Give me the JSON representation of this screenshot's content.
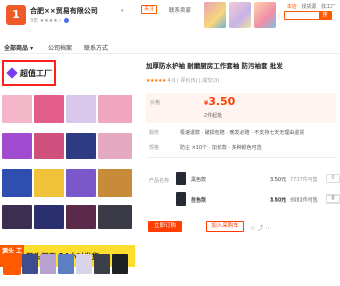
{
  "header": {
    "logo_char": "1",
    "shop_name": "合肥××贸易有限公司",
    "shop_meta_text": "3年 ★★★★☆",
    "chevron": "▾",
    "follow_label": "关注",
    "contact_label": "联系卖家",
    "links": {
      "first": "本店",
      "second": "找货源",
      "third": "找工厂"
    },
    "search_button": "搜"
  },
  "nav": {
    "items": [
      "全部商品 ▾",
      "公司档案",
      "联系方式"
    ]
  },
  "gallery": {
    "badge_label": "超值工厂",
    "banner_side": "源头 工厂",
    "banner_text": "源头厂家 24小时发货"
  },
  "product": {
    "title": "加厚防水护袖 耐磨厨房工作套袖 防污袖套 批发",
    "rating_stars": "★★★★★",
    "rating_text": "4.0 | 评价(5) | 成交(3)",
    "price_label": "价格",
    "price_currency": "¥",
    "price_value": "3.50",
    "moq": "2件起批",
    "service_label": "服务",
    "service_text": "极速退款 · 破损包赔 · 晚发必赔 · 不支持七天无理由退货",
    "spec_label": "规格",
    "spec_text": "防尘 ×10个 · 加长款 · 多种颜色可选",
    "variant_head": "产品名称",
    "variants": [
      {
        "name": "黑色款",
        "price": "3.50元",
        "stock": "7737件可售",
        "qty": "0"
      },
      {
        "name": "蓝色款",
        "price": "3.50元",
        "stock": "2652件可售",
        "qty": "0"
      },
      {
        "name": "灰色款",
        "price": "3.50元",
        "stock": "4081件可售",
        "qty": "0"
      }
    ],
    "buy_label": "立即订购",
    "cart_label": "加入采购车",
    "mini_icons": "☆  ⤴  ⋯"
  },
  "colors": {
    "accent": "#ff5a00",
    "price": "#ff3d00",
    "badge_border": "#ff1f1f",
    "banner_yellow": "#ffdd2e"
  }
}
